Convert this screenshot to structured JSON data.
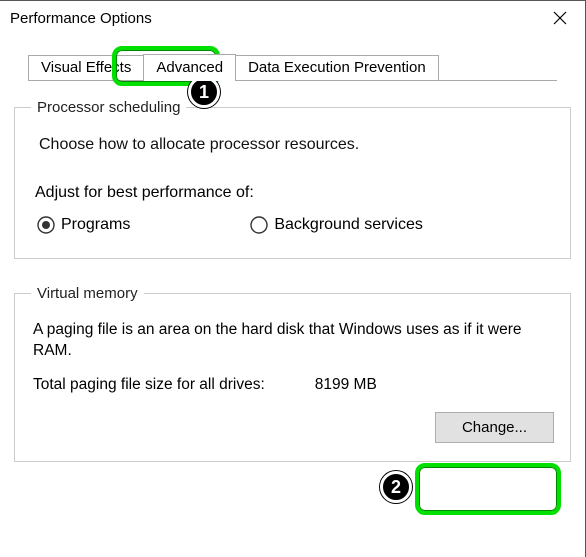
{
  "window": {
    "title": "Performance Options"
  },
  "tabs": {
    "visual_effects": "Visual Effects",
    "advanced": "Advanced",
    "dep": "Data Execution Prevention"
  },
  "processor": {
    "legend": "Processor scheduling",
    "desc": "Choose how to allocate processor resources.",
    "adjust": "Adjust for best performance of:",
    "programs": "Programs",
    "background": "Background services"
  },
  "vm": {
    "legend": "Virtual memory",
    "desc": "A paging file is an area on the hard disk that Windows uses as if it were RAM.",
    "total_label": "Total paging file size for all drives:",
    "total_value": "8199 MB",
    "change": "Change..."
  },
  "annotations": {
    "b1": "1",
    "b2": "2"
  }
}
